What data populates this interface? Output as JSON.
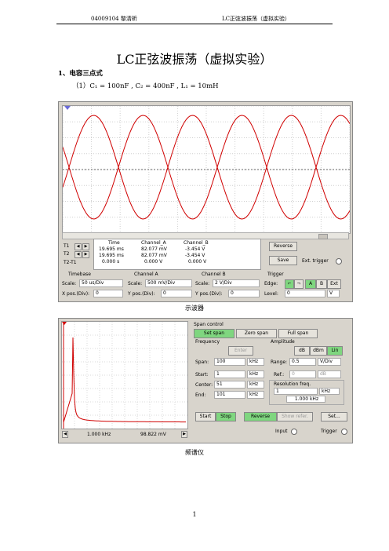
{
  "header": {
    "left": "04009104  黎清昕",
    "right": "LC正弦波振荡（虚拟实验）"
  },
  "title": "LC正弦波振荡（虚拟实验）",
  "section": "1、电容三点式",
  "formula": "（1）C₁ = 100nF , C₂ = 400nF , L₁ = 10mH",
  "oscilloscope": {
    "caption": "示波器",
    "cursor_labels": [
      "T1",
      "T2",
      "T2-T1"
    ],
    "table_headers": [
      "Time",
      "Channel_A",
      "Channel_B"
    ],
    "rows": [
      [
        "19.695 ms",
        "82.077 mV",
        "-3.454 V"
      ],
      [
        "19.695 ms",
        "82.077 mV",
        "-3.454 V"
      ],
      [
        "0.000 s",
        "0.000 V",
        "0.000 V"
      ]
    ],
    "reverse_label": "Reverse",
    "save_label": "Save",
    "ext_trigger_label": "Ext. trigger",
    "timebase": {
      "title": "Timebase",
      "scale_label": "Scale:",
      "scale": "50 us/Div",
      "xpos_label": "X pos.(Div):",
      "xpos": "0"
    },
    "channel_a": {
      "title": "Channel A",
      "scale_label": "Scale:",
      "scale": "500 mV/Div",
      "ypos_label": "Y pos.(Div):",
      "ypos": "0"
    },
    "channel_b": {
      "title": "Channel B",
      "scale_label": "Scale:",
      "scale": "2  V/Div",
      "ypos_label": "Y pos.(Div):",
      "ypos": "0"
    },
    "trigger": {
      "title": "Trigger",
      "edge_label": "Edge:",
      "buttons": [
        "A",
        "B",
        "Ext"
      ],
      "level_label": "Level:",
      "level": "0",
      "level_unit": "V"
    },
    "trace_color": "#d00000"
  },
  "spectrum": {
    "caption": "频谱仪",
    "span_control_label": "Span control",
    "span_buttons": [
      "Set span",
      "Zero span",
      "Full span"
    ],
    "frequency_label": "Frequency",
    "enter_label": "Enter",
    "amplitude_label": "Amplitude",
    "amp_buttons": [
      "dB",
      "dBm",
      "Lin"
    ],
    "span_label": "Span:",
    "span": "100",
    "span_unit": "kHz",
    "start_label": "Start:",
    "start": "1",
    "start_unit": "kHz",
    "center_label": "Center:",
    "center": "51",
    "center_unit": "kHz",
    "end_label": "End:",
    "end": "101",
    "end_unit": "kHz",
    "range_label": "Range:",
    "range": "0.5",
    "range_unit": "V/Div",
    "ref_label": "Ref.:",
    "ref": "0",
    "ref_unit": "dB",
    "resolution_label": "Resolution freq.",
    "resolution": "1",
    "resolution_unit": "kHz",
    "resolution_readout": "1.000 kHz",
    "cursor_freq": "1.000 kHz",
    "cursor_amp": "98.822 mV",
    "bottom_buttons": [
      "Start",
      "Stop",
      "Reverse",
      "Show refer.",
      "Set..."
    ],
    "input_label": "Input",
    "trigger_label": "Trigger",
    "trace_color": "#d00000"
  },
  "page_number": "1"
}
